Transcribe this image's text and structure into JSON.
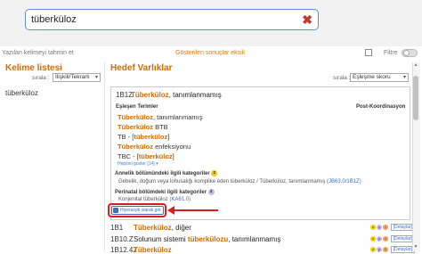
{
  "search": {
    "value": "tüberküloz",
    "clear_icon": "close-icon"
  },
  "hint": {
    "left": "Yazılan kelimeyi tahmin et",
    "middle": "Gösterilen sonuçlar eksik",
    "filter_label": "Filtre"
  },
  "word_list": {
    "title": "Kelime listesi",
    "sort_label": "sırala :",
    "sort_value": "İlişkili/Tekrarlı",
    "items": [
      "tüberküloz"
    ]
  },
  "target": {
    "title": "Hedef Varlıklar",
    "sort_label": "sırala :",
    "sort_value": "Eşleşme skoru",
    "main": {
      "code": "1B1Z",
      "title_pre": "Tüberküloz",
      "title_post": ", tanımlanmamış",
      "matching_terms_header": "Eşleşen Terimler",
      "post_coord_header": "Post-Koordinasyon",
      "terms": [
        {
          "hl": "Tüberküloz",
          "rest": ", tanımlanmamış"
        },
        {
          "hl": "Tüberküloz",
          "rest": " BTB"
        },
        {
          "pre": "TB - [",
          "hl": "tüberküloz",
          "rest": "]"
        },
        {
          "hl": "Tüberküloz",
          "rest": " enfeksiyonu"
        },
        {
          "pre": "TBC - [",
          "hl": "tüberküloz",
          "rest": "]"
        }
      ],
      "show_more": "Hepsini göster [14] ▾",
      "section1_title": "Annelik bölümündeki ilgili kategoriler",
      "section1_desc": "Gebelik, doğum veya lohusalığı komplike eden tüberküloz / Tüberküloz, tanımlanmamış",
      "section1_code": "(JB63.0/1B1Z)",
      "section2_title": "Perinatal bölümdeki ilgili kategoriler",
      "section2_desc": "Konjenital tüberküloz",
      "section2_code": "(KA61.0)",
      "hierarchy_button": "Hiyerarşik olarak gör"
    },
    "results": [
      {
        "code": "1B1",
        "hl": "Tüberküloz",
        "rest": ", diğer",
        "detail": "[Detaylar]"
      },
      {
        "code": "1B10.Z",
        "pre": "Solunum sistemi ",
        "hl": "tüberkülozu",
        "rest": ", tanımlanmamış",
        "detail": "[Detaylar]"
      },
      {
        "code": "1B12.42",
        "pre": "",
        "hl": "Tüberküloz",
        "rest": "",
        "detail": "[Detaylar]"
      }
    ]
  },
  "badges": {
    "section1": "z",
    "section2": "z",
    "dots": [
      "z",
      "p",
      "t"
    ]
  }
}
